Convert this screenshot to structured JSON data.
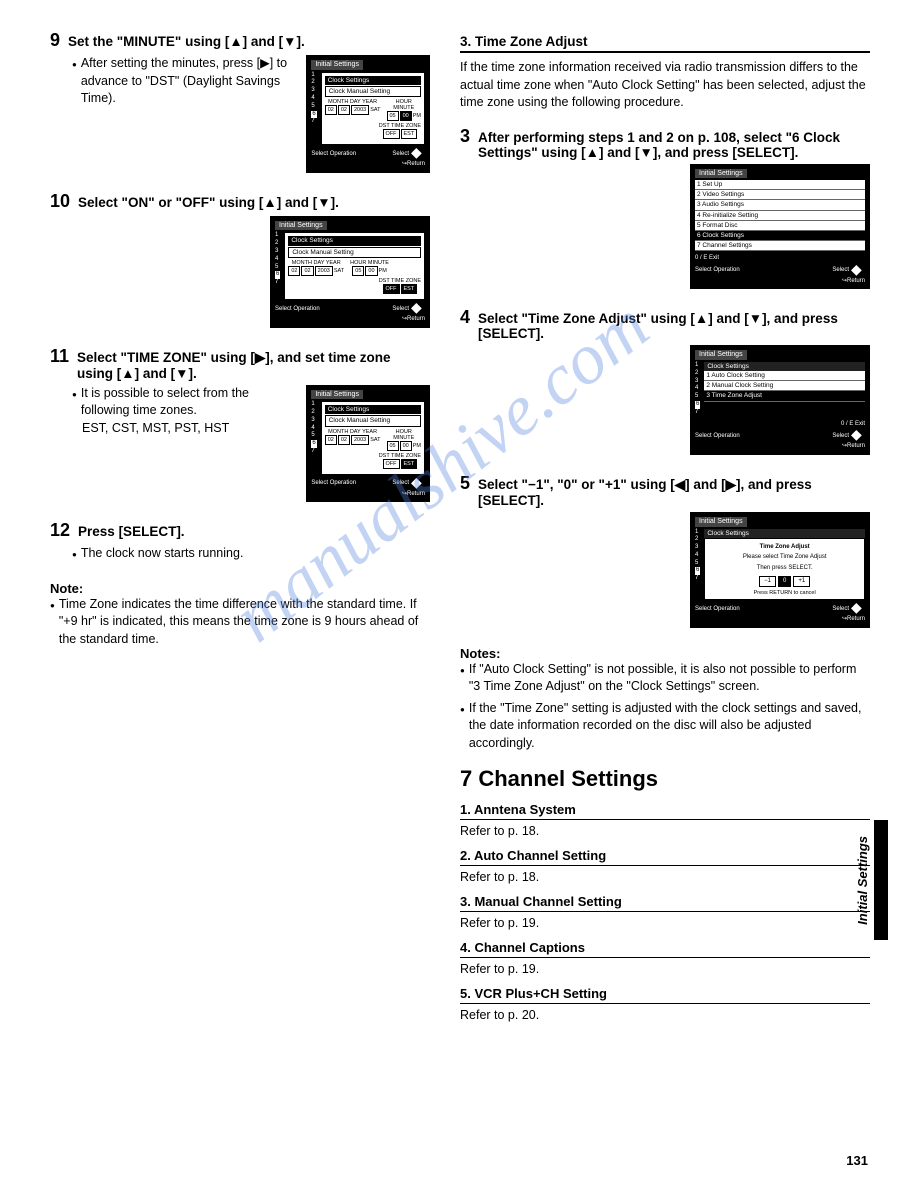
{
  "watermark": "manualshive.com",
  "page_number": "131",
  "side_tab": "Initial Settings",
  "left": {
    "step9": {
      "num": "9",
      "title": "Set the \"MINUTE\" using [▲] and [▼].",
      "body": "After setting the minutes, press [▶] to advance to \"DST\" (Daylight Savings Time).",
      "shot": {
        "title": "Initial Settings",
        "sub": "Clock Settings",
        "sub2": "Clock Manual Setting",
        "labels_date": [
          "MONTH",
          "DAY",
          "YEAR"
        ],
        "vals_date": [
          "02",
          "02",
          "2003"
        ],
        "day": "SAT",
        "labels_time": [
          "HOUR",
          "MINUTE"
        ],
        "vals_time": [
          "05",
          "00"
        ],
        "ampm": "PM",
        "labels_ext": [
          "DST",
          "TIME ZONE"
        ],
        "vals_ext": [
          "OFF",
          "EST"
        ],
        "foot_left": "Select Operation",
        "foot_sel": "Select",
        "foot_ret": "Return"
      }
    },
    "step10": {
      "num": "10",
      "title": "Select \"ON\" or \"OFF\" using [▲] and [▼].",
      "shot": {
        "title": "Initial Settings",
        "sub": "Clock Settings",
        "sub2": "Clock Manual Setting",
        "labels_date": [
          "MONTH",
          "DAY",
          "YEAR"
        ],
        "vals_date": [
          "02",
          "02",
          "2003"
        ],
        "day": "SAT",
        "labels_time": [
          "HOUR",
          "MINUTE"
        ],
        "vals_time": [
          "05",
          "00"
        ],
        "ampm": "PM",
        "labels_ext": [
          "DST",
          "TIME ZONE"
        ],
        "vals_ext": [
          "OFF",
          "EST"
        ],
        "foot_left": "Select Operation",
        "foot_sel": "Select",
        "foot_ret": "Return"
      }
    },
    "step11": {
      "num": "11",
      "title": "Select \"TIME ZONE\" using [▶], and set time zone using [▲] and [▼].",
      "body": "It is possible to select from the following time zones.",
      "zones": "EST, CST, MST, PST, HST",
      "shot": {
        "title": "Initial Settings",
        "sub": "Clock Settings",
        "sub2": "Clock Manual Setting",
        "labels_date": [
          "MONTH",
          "DAY",
          "YEAR"
        ],
        "vals_date": [
          "02",
          "02",
          "2003"
        ],
        "day": "SAT",
        "labels_time": [
          "HOUR",
          "MINUTE"
        ],
        "vals_time": [
          "05",
          "00"
        ],
        "ampm": "PM",
        "labels_ext": [
          "DST",
          "TIME ZONE"
        ],
        "vals_ext": [
          "OFF",
          "EST"
        ],
        "foot_left": "Select Operation",
        "foot_sel": "Select",
        "foot_ret": "Return"
      }
    },
    "step12": {
      "num": "12",
      "title": "Press [SELECT].",
      "body": "The clock now starts running."
    },
    "note": {
      "head": "Note:",
      "body": "Time Zone indicates the time difference with the standard time. If \"+9 hr\" is indicated, this means the time zone is 9 hours ahead of the standard time."
    }
  },
  "right": {
    "tz_heading": "3. Time Zone Adjust",
    "tz_intro": "If the time zone information received via radio transmission differs to the actual time zone when \"Auto Clock Setting\" has been selected, adjust the time zone using the following procedure.",
    "step3": {
      "num": "3",
      "title": "After performing steps 1 and 2 on p. 108, select \"6 Clock Settings\" using [▲] and [▼], and press [SELECT].",
      "shot": {
        "title": "Initial Settings",
        "menu": [
          "1   Set Up",
          "2   Video Settings",
          "3   Audio Settings",
          "4   Re-initialize Setting",
          "5   Format Disc",
          "6   Clock Settings",
          "7   Channel Settings"
        ],
        "hl_index": 5,
        "exit": "0 / E Exit",
        "foot_left": "Select Operation",
        "foot_sel": "Select",
        "foot_ret": "Return"
      }
    },
    "step4": {
      "num": "4",
      "title": "Select \"Time Zone Adjust\" using [▲] and [▼], and press [SELECT].",
      "shot": {
        "title": "Initial Settings",
        "sub": "Clock Settings",
        "menu": [
          "1   Auto Clock Setting",
          "2   Manual Clock Setting",
          "3   Time Zone Adjust"
        ],
        "hl_index": 2,
        "exit": "0 / E Exit",
        "foot_left": "Select Operation",
        "foot_sel": "Select",
        "foot_ret": "Return"
      }
    },
    "step5": {
      "num": "5",
      "title": "Select \"−1\", \"0\" or \"+1\" using [◀] and [▶], and press [SELECT].",
      "shot": {
        "title": "Initial Settings",
        "sub": "Clock Settings",
        "sub2": "Time Zone Adjust",
        "msg1": "Please select  Time Zone Adjust",
        "msg2": "Then press SELECT.",
        "opts": [
          "−1",
          "0",
          "+1"
        ],
        "ret": "Press RETURN to cancel",
        "foot_left": "Select Operation",
        "foot_sel": "Select",
        "foot_ret": "Return"
      }
    },
    "notes": {
      "head": "Notes:",
      "n1": "If \"Auto Clock Setting\" is not possible, it is also not possible to perform \"3 Time Zone Adjust\" on the \"Clock Settings\" screen.",
      "n2": "If the \"Time Zone\" setting is adjusted with the clock settings and saved, the date information recorded on the disc will also be adjusted accordingly."
    },
    "ch_heading": "7 Channel Settings",
    "ch1": {
      "title": "1. Anntena System",
      "ref": "Refer to p. 18."
    },
    "ch2": {
      "title": "2. Auto Channel Setting",
      "ref": "Refer to p. 18."
    },
    "ch3": {
      "title": "3. Manual Channel Setting",
      "ref": "Refer to p. 19."
    },
    "ch4": {
      "title": "4. Channel Captions",
      "ref": "Refer to p. 19."
    },
    "ch5": {
      "title": "5. VCR Plus+CH Setting",
      "ref": "Refer to p. 20."
    }
  }
}
